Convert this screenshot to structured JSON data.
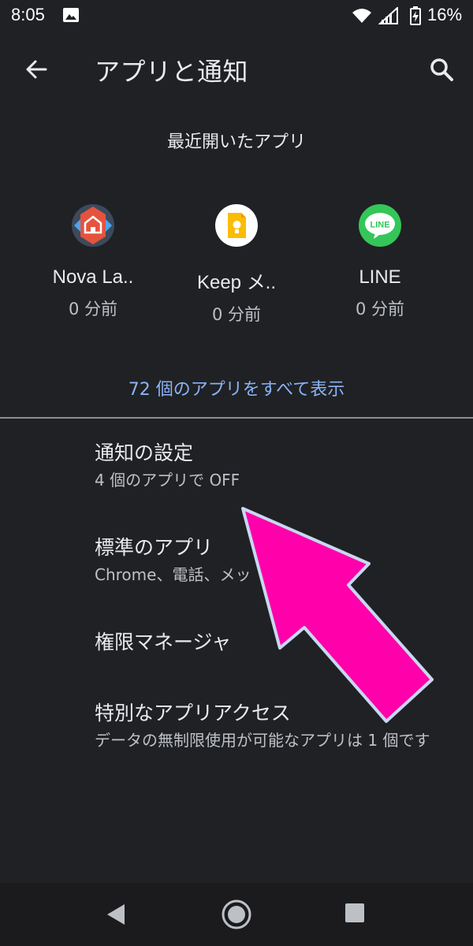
{
  "status_bar": {
    "time": "8:05",
    "battery_percent": "16%"
  },
  "app_bar": {
    "title": "アプリと通知"
  },
  "recent": {
    "header": "最近開いたアプリ",
    "apps": [
      {
        "name": "Nova La..",
        "time": "0 分前"
      },
      {
        "name": "Keep メ..",
        "time": "0 分前"
      },
      {
        "name": "LINE",
        "time": "0 分前"
      }
    ],
    "see_all": "72 個のアプリをすべて表示"
  },
  "settings": [
    {
      "title": "通知の設定",
      "summary": "4 個のアプリで OFF"
    },
    {
      "title": "標準のアプリ",
      "summary": "Chrome、電話、メッ"
    },
    {
      "title": "権限マネージャ",
      "summary": ""
    },
    {
      "title": "特別なアプリアクセス",
      "summary": "データの無制限使用が可能なアプリは 1 個です"
    }
  ],
  "icons": {
    "line_label": "LINE"
  },
  "colors": {
    "background": "#202124",
    "accent_link": "#8ab4f8",
    "arrow_fill": "#ff00aa",
    "arrow_stroke": "#c8d8f0",
    "line_green": "#34c659",
    "keep_yellow": "#fbbc04"
  }
}
